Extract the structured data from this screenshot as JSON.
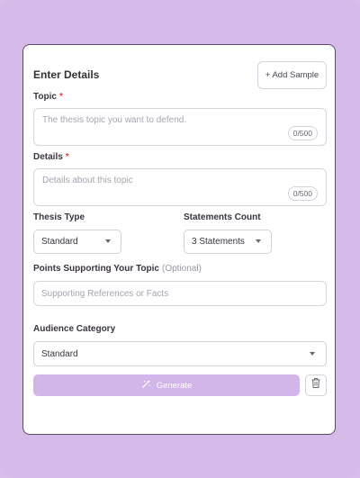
{
  "header": {
    "title": "Enter Details",
    "add_sample_label": "+ Add Sample"
  },
  "topic": {
    "label": "Topic",
    "required_mark": "*",
    "placeholder": "The thesis topic you want to defend.",
    "counter": "0/500"
  },
  "details": {
    "label": "Details",
    "required_mark": "*",
    "placeholder": "Details about this topic",
    "counter": "0/500"
  },
  "thesis_type": {
    "label": "Thesis Type",
    "value": "Standard"
  },
  "statements_count": {
    "label": "Statements Count",
    "value": "3 Statements"
  },
  "supporting_points": {
    "label": "Points Supporting Your Topic",
    "optional": "(Optional)",
    "placeholder": "Supporting References or Facts"
  },
  "audience": {
    "label": "Audience Category",
    "value": "Standard"
  },
  "actions": {
    "generate_label": "Generate"
  },
  "colors": {
    "background": "#d6bbea",
    "generate_button": "#d2b6ea",
    "required": "#e04444"
  },
  "icons": {
    "generate": "magic-wand-icon",
    "delete": "trash-icon",
    "dropdown": "chevron-down-icon"
  }
}
